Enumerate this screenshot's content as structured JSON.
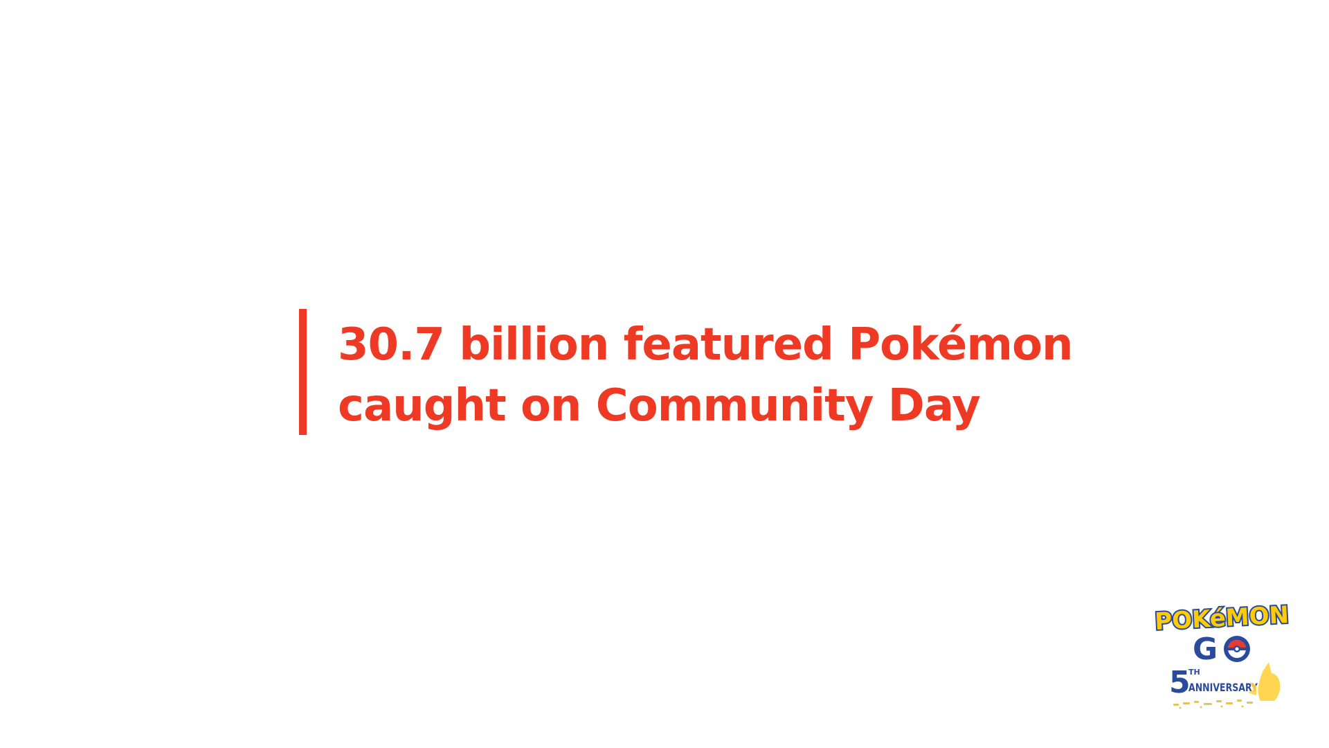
{
  "stat": {
    "line1": "30.7 billion featured Pokémon",
    "line2": "caught on Community Day"
  },
  "logo": {
    "word_top": "POKéMON",
    "word_go": "GO",
    "anniversary_number": "5",
    "anniversary_ordinal": "TH",
    "anniversary_word": "ANNIVERSARY",
    "icon": "pokemon-go-5th-anniversary-logo"
  },
  "colors": {
    "accent": "#ee3a24",
    "logo_yellow": "#ffcb05",
    "logo_blue": "#2a4a9c",
    "background": "#ffffff"
  }
}
